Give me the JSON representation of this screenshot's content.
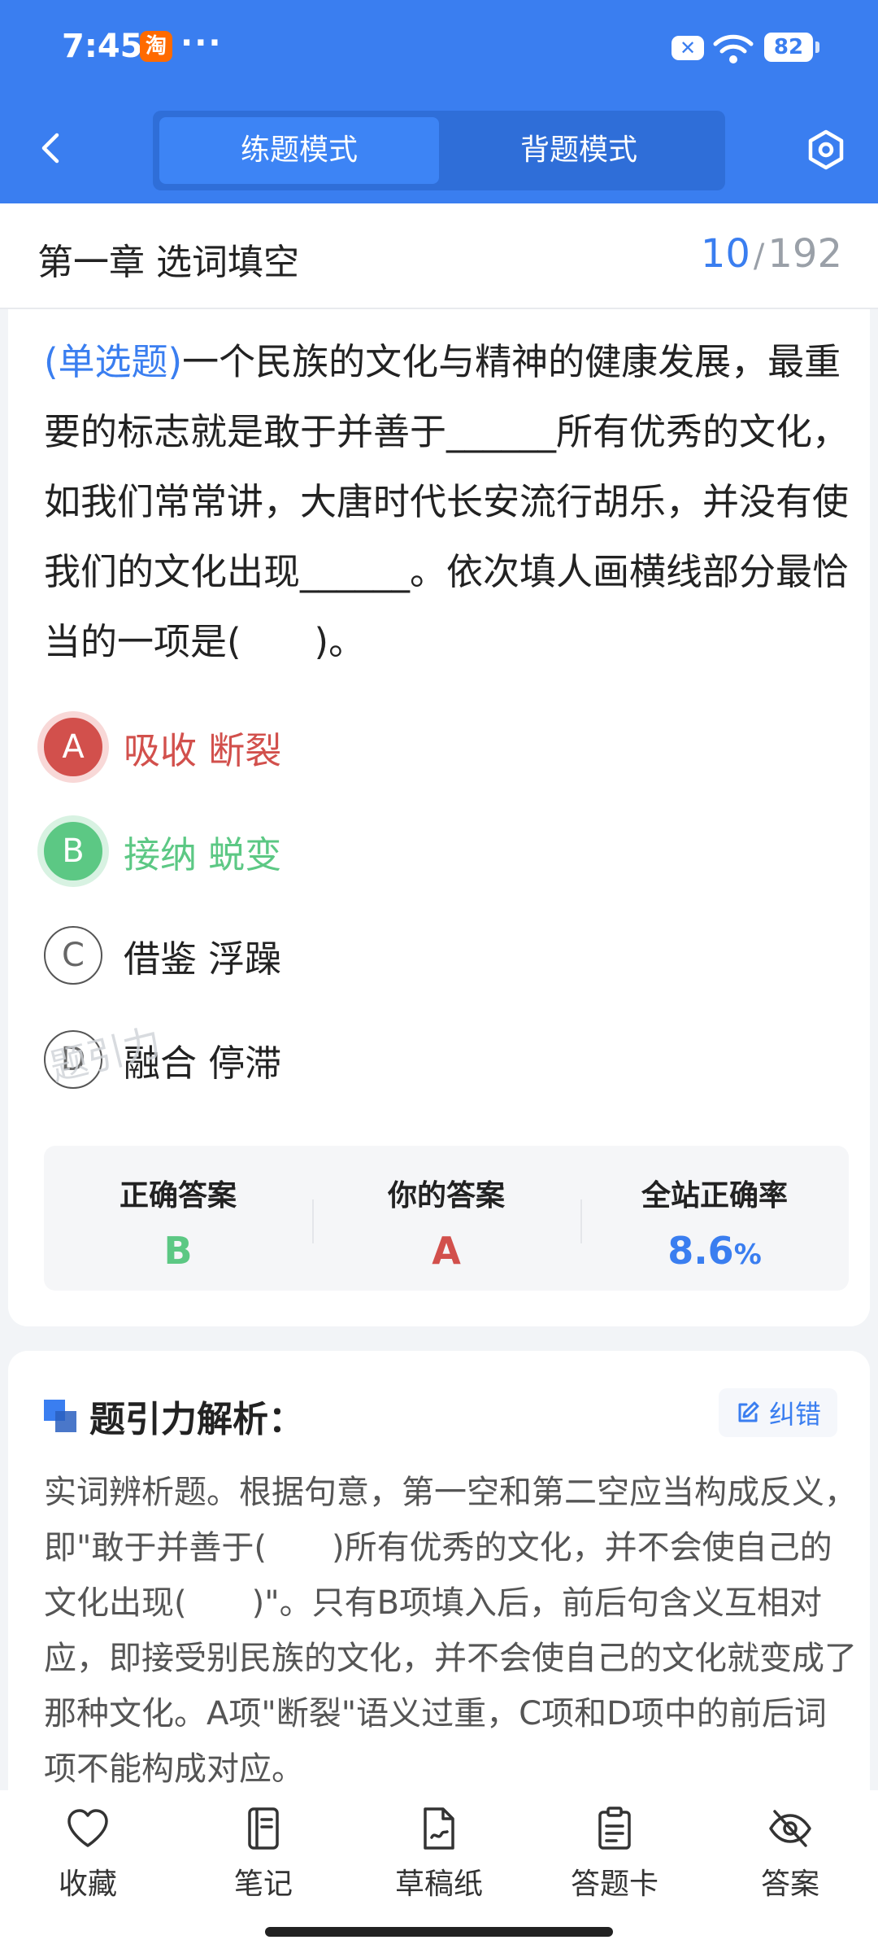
{
  "status_bar": {
    "time": "7:45",
    "app_badge": "淘",
    "overflow": "···",
    "battery": "82"
  },
  "header": {
    "tabs": [
      {
        "label": "练题模式",
        "active": true
      },
      {
        "label": "背题模式",
        "active": false
      }
    ]
  },
  "chapter": {
    "title": "第一章 选词填空",
    "current": "10",
    "separator": "/",
    "total": "192"
  },
  "question": {
    "type": "(单选题)",
    "text": "一个民族的文化与精神的健康发展，最重要的标志就是敢于并善于______所有优秀的文化，如我们常常讲，大唐时代长安流行胡乐，并没有使我们的文化出现______。依次填人画横线部分最恰当的一项是(　　)。",
    "options": [
      {
        "letter": "A",
        "text": "吸收 断裂",
        "state": "wrong"
      },
      {
        "letter": "B",
        "text": "接纳 蜕变",
        "state": "correct"
      },
      {
        "letter": "C",
        "text": "借鉴 浮躁",
        "state": "none"
      },
      {
        "letter": "D",
        "text": "融合 停滞",
        "state": "none"
      }
    ],
    "watermark": "题引力"
  },
  "stats": {
    "correct_label": "正确答案",
    "correct_value": "B",
    "yours_label": "你的答案",
    "yours_value": "A",
    "rate_label": "全站正确率",
    "rate_value": "8.6",
    "rate_unit": "%"
  },
  "analysis": {
    "title": "题引力解析：",
    "report_label": "纠错",
    "text": "实词辨析题。根据句意，第一空和第二空应当构成反义，即\"敢于并善于(　　)所有优秀的文化，并不会使自己的文化出现(　　)\"。只有B项填入后，前后句含义互相对应，即接受别民族的文化，并不会使自己的文化就变成了那种文化。A项\"断裂\"语义过重，C项和D项中的前后词项不能构成对应。"
  },
  "bottom_nav": [
    {
      "label": "收藏",
      "icon": "heart-icon"
    },
    {
      "label": "笔记",
      "icon": "notebook-icon"
    },
    {
      "label": "草稿纸",
      "icon": "draft-paper-icon"
    },
    {
      "label": "答题卡",
      "icon": "answer-sheet-icon"
    },
    {
      "label": "答案",
      "icon": "eye-off-icon"
    }
  ],
  "colors": {
    "primary": "#3a7ef0",
    "correct": "#5cc884",
    "wrong": "#d2504c"
  }
}
